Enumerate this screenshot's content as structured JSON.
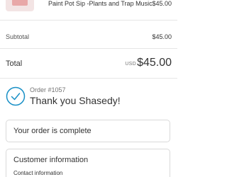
{
  "line_item": {
    "name": "Paint Pot Sip -Plants and Trap Music",
    "price": "$45.00",
    "thumbnail_icon": "product-thumbnail"
  },
  "subtotal": {
    "label": "Subtotal",
    "value": "$45.00"
  },
  "total": {
    "label": "Total",
    "currency": "USD",
    "value": "$45.00"
  },
  "confirmation": {
    "icon": "check-circle-icon",
    "accent_color": "#1990c6",
    "order_number": "Order #1057",
    "thank_you": "Thank you Shasedy!"
  },
  "status_panel": {
    "title": "Your order is complete"
  },
  "customer_panel": {
    "title": "Customer information",
    "subtitle": "Contact information"
  }
}
